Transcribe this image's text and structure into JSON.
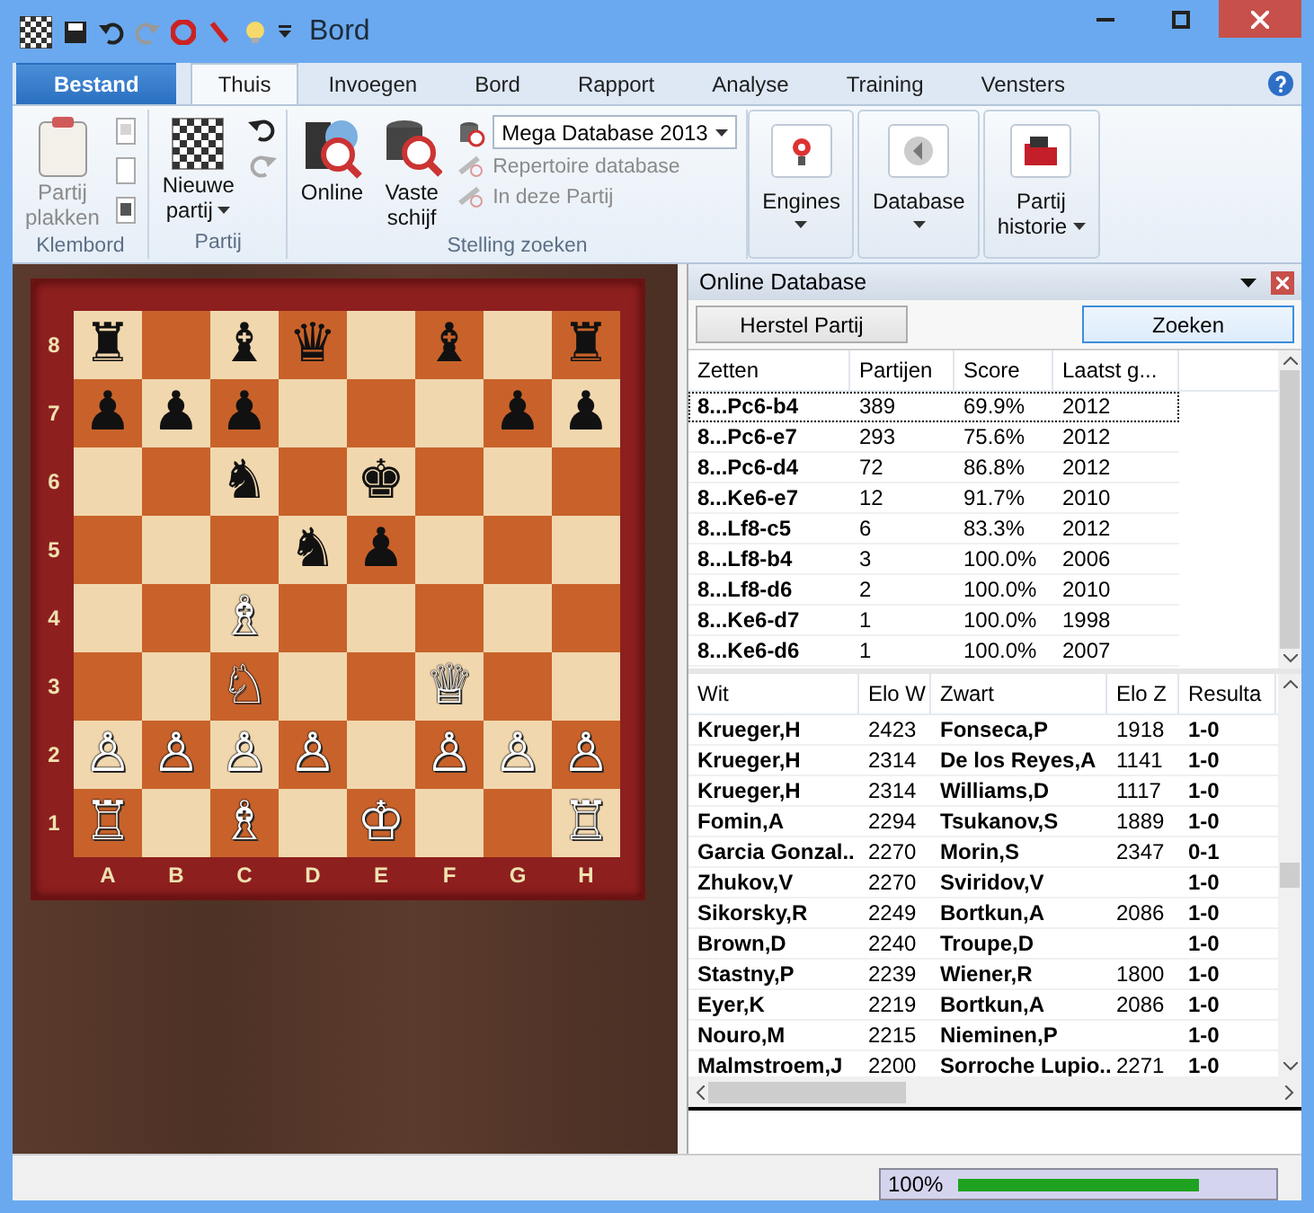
{
  "window": {
    "title": "Bord"
  },
  "tabs": [
    {
      "label": "Bestand",
      "kind": "file",
      "selected": false
    },
    {
      "label": "Thuis",
      "kind": "tab",
      "selected": true
    },
    {
      "label": "Invoegen",
      "kind": "tab",
      "selected": false
    },
    {
      "label": "Bord",
      "kind": "tab",
      "selected": false
    },
    {
      "label": "Rapport",
      "kind": "tab",
      "selected": false
    },
    {
      "label": "Analyse",
      "kind": "tab",
      "selected": false
    },
    {
      "label": "Training",
      "kind": "tab",
      "selected": false
    },
    {
      "label": "Vensters",
      "kind": "tab",
      "selected": false
    }
  ],
  "ribbon": {
    "groups": [
      {
        "label": "Klembord",
        "items": [
          {
            "kind": "large",
            "label": "Partij plakken",
            "disabled": true,
            "dropdown": false
          },
          {
            "kind": "icons"
          }
        ]
      },
      {
        "label": "Partij",
        "items": [
          {
            "kind": "large",
            "label": "Nieuwe partij",
            "disabled": false,
            "dropdown": true
          },
          {
            "kind": "icons"
          }
        ]
      },
      {
        "label": "Stelling zoeken",
        "items": [
          {
            "kind": "large",
            "label": "Online",
            "disabled": false,
            "dropdown": false
          },
          {
            "kind": "large",
            "label": "Vaste schijf",
            "disabled": false,
            "dropdown": false
          },
          {
            "kind": "stack",
            "combo": "Mega Database 2013",
            "entries": [
              {
                "label": "Repertoire database",
                "disabled": true
              },
              {
                "label": "In deze Partij",
                "disabled": true
              }
            ]
          }
        ]
      },
      {
        "items": [
          {
            "kind": "box",
            "label": "Engines",
            "dropdown": true,
            "disabled": false
          }
        ]
      },
      {
        "items": [
          {
            "kind": "box",
            "label": "Database",
            "dropdown": true,
            "disabled": false
          }
        ]
      },
      {
        "items": [
          {
            "kind": "box",
            "label": "Partij historie",
            "dropdown": true,
            "disabled": false
          }
        ]
      }
    ]
  },
  "board": {
    "ranks": [
      "8",
      "7",
      "6",
      "5",
      "4",
      "3",
      "2",
      "1"
    ],
    "files": [
      "A",
      "B",
      "C",
      "D",
      "E",
      "F",
      "G",
      "H"
    ],
    "rows": [
      [
        "♜",
        "",
        "♝",
        "♛",
        "",
        "♝",
        "",
        "♜"
      ],
      [
        "♟",
        "♟",
        "♟",
        "",
        "",
        "",
        "♟",
        "♟"
      ],
      [
        "",
        "",
        "♞",
        "",
        "♚",
        "",
        "",
        ""
      ],
      [
        "",
        "",
        "",
        "♞",
        "♟",
        "",
        "",
        ""
      ],
      [
        "",
        "",
        "♗",
        "",
        "",
        "",
        "",
        ""
      ],
      [
        "",
        "",
        "♘",
        "",
        "",
        "♕",
        "",
        ""
      ],
      [
        "♙",
        "♙",
        "♙",
        "♙",
        "",
        "♙",
        "♙",
        "♙"
      ],
      [
        "♖",
        "",
        "♗",
        "",
        "♔",
        "",
        "",
        "♖"
      ]
    ]
  },
  "panel": {
    "title": "Online Database",
    "buttons": [
      {
        "label": "Herstel Partij",
        "kind": "plain"
      },
      {
        "label": "Zoeken",
        "kind": "default"
      }
    ],
    "moves": {
      "columns": [
        "Zetten",
        "Partijen",
        "Score",
        "Laatst g..."
      ],
      "rows": [
        {
          "cells": [
            "8...Pc6-b4",
            "389",
            "69.9%",
            "2012"
          ],
          "selected": true
        },
        {
          "cells": [
            "8...Pc6-e7",
            "293",
            "75.6%",
            "2012"
          ],
          "selected": false
        },
        {
          "cells": [
            "8...Pc6-d4",
            "72",
            "86.8%",
            "2012"
          ],
          "selected": false
        },
        {
          "cells": [
            "8...Ke6-e7",
            "12",
            "91.7%",
            "2010"
          ],
          "selected": false
        },
        {
          "cells": [
            "8...Lf8-c5",
            "6",
            "83.3%",
            "2012"
          ],
          "selected": false
        },
        {
          "cells": [
            "8...Lf8-b4",
            "3",
            "100.0%",
            "2006"
          ],
          "selected": false
        },
        {
          "cells": [
            "8...Lf8-d6",
            "2",
            "100.0%",
            "2010"
          ],
          "selected": false
        },
        {
          "cells": [
            "8...Ke6-d7",
            "1",
            "100.0%",
            "1998"
          ],
          "selected": false
        },
        {
          "cells": [
            "8...Ke6-d6",
            "1",
            "100.0%",
            "2007"
          ],
          "selected": false
        }
      ]
    },
    "games": {
      "columns": [
        "Wit",
        "Elo W",
        "Zwart",
        "Elo Z",
        "Resulta"
      ],
      "rows": [
        [
          "Krueger,H",
          "2423",
          "Fonseca,P",
          "1918",
          "1-0"
        ],
        [
          "Krueger,H",
          "2314",
          "De los Reyes,A",
          "1141",
          "1-0"
        ],
        [
          "Krueger,H",
          "2314",
          "Williams,D",
          "1117",
          "1-0"
        ],
        [
          "Fomin,A",
          "2294",
          "Tsukanov,S",
          "1889",
          "1-0"
        ],
        [
          "Garcia Gonzal..",
          "2270",
          "Morin,S",
          "2347",
          "0-1"
        ],
        [
          "Zhukov,V",
          "2270",
          "Sviridov,V",
          "",
          "1-0"
        ],
        [
          "Sikorsky,R",
          "2249",
          "Bortkun,A",
          "2086",
          "1-0"
        ],
        [
          "Brown,D",
          "2240",
          "Troupe,D",
          "",
          "1-0"
        ],
        [
          "Stastny,P",
          "2239",
          "Wiener,R",
          "1800",
          "1-0"
        ],
        [
          "Eyer,K",
          "2219",
          "Bortkun,A",
          "2086",
          "1-0"
        ],
        [
          "Nouro,M",
          "2215",
          "Nieminen,P",
          "",
          "1-0"
        ],
        [
          "Malmstroem,J",
          "2200",
          "Sorroche Lupio..",
          "2271",
          "1-0"
        ]
      ]
    }
  },
  "status_bar": {
    "progress": {
      "reading": "100%",
      "level": 1
    }
  }
}
